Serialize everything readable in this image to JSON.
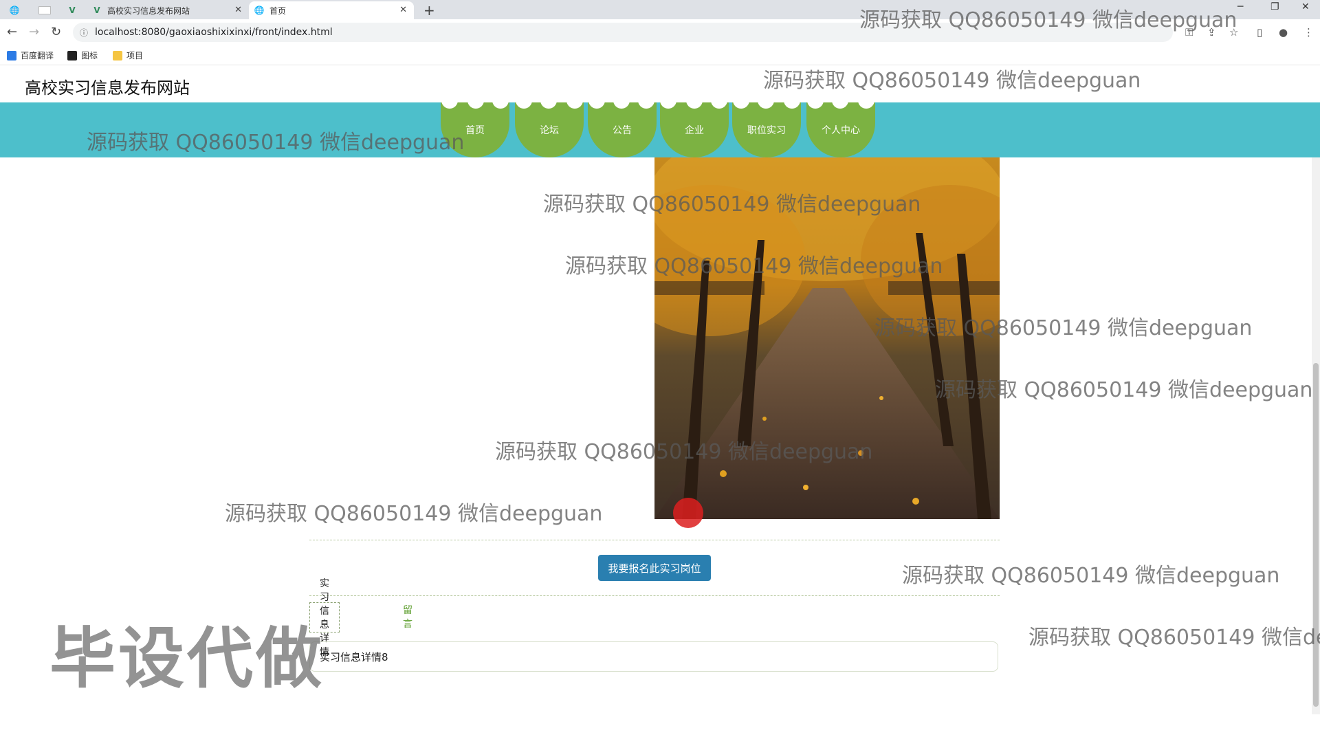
{
  "browser": {
    "tabs": [
      {
        "label": ""
      },
      {
        "label": ""
      },
      {
        "label": "高校实习信息发布网站"
      },
      {
        "label": "首页"
      }
    ],
    "url": "localhost:8080/gaoxiaoshixixinxi/front/index.html",
    "bookmarks": [
      "百度翻译",
      "图标",
      "项目"
    ]
  },
  "site": {
    "title": "高校实习信息发布网站",
    "nav": [
      "首页",
      "论坛",
      "公告",
      "企业",
      "职位实习",
      "个人中心"
    ]
  },
  "detail": {
    "apply_button": "我要报名此实习岗位",
    "tabs": [
      "实习信息详情",
      "留言"
    ],
    "content": "实习信息详情8"
  },
  "watermarks": {
    "text": "源码获取 QQ86050149 微信deepguan",
    "partial": "源码获取 QQ86050149 微信de",
    "big": "毕设代做"
  },
  "colors": {
    "nav_band": "#4dbfcb",
    "nav_item": "#7cb242",
    "apply_button": "#2a7fb0"
  }
}
